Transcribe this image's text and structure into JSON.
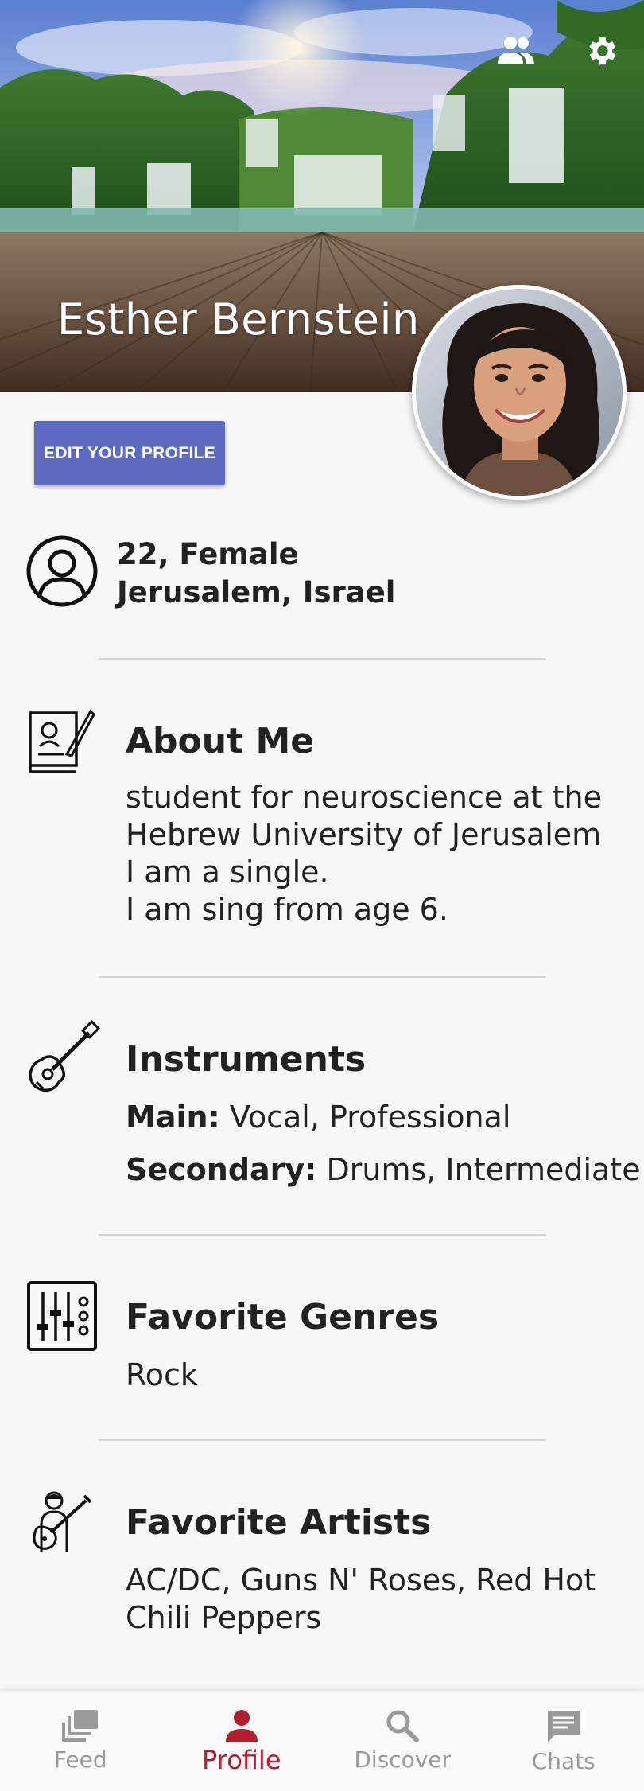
{
  "header": {
    "name": "Esther Bernstein",
    "friends_icon": "people-icon",
    "settings_icon": "gear-icon"
  },
  "edit_button_label": "EDIT YOUR PROFILE",
  "basic_info": {
    "age_gender": "22, Female",
    "location": "Jerusalem, Israel",
    "icon": "person-circle-icon"
  },
  "about": {
    "title": "About Me",
    "lines": [
      "student for neuroscience at the",
      "Hebrew University of Jerusalem",
      "I am a single.",
      "I am sing from age 6."
    ],
    "icon": "book-quill-icon"
  },
  "instruments": {
    "title": "Instruments",
    "main_label": "Main:",
    "main_value": "Vocal, Professional",
    "secondary_label": "Secondary:",
    "secondary_value": "Drums, Intermediate",
    "icon": "guitar-icon"
  },
  "genres": {
    "title": "Favorite Genres",
    "value": "Rock",
    "icon": "mixer-icon"
  },
  "artists": {
    "title": "Favorite Artists",
    "lines": [
      "AC/DC, Guns N' Roses, Red Hot",
      "Chili Peppers"
    ],
    "icon": "guitarist-icon"
  },
  "nav": {
    "items": [
      {
        "label": "Feed",
        "icon": "feed-icon"
      },
      {
        "label": "Profile",
        "icon": "person-icon"
      },
      {
        "label": "Discover",
        "icon": "search-icon"
      },
      {
        "label": "Chats",
        "icon": "chat-icon"
      }
    ],
    "active": "Profile",
    "active_color": "#b51d2d",
    "inactive_color": "#9a9a9a"
  },
  "colors": {
    "button": "#5c6bc0",
    "background": "#f7f7f7"
  }
}
